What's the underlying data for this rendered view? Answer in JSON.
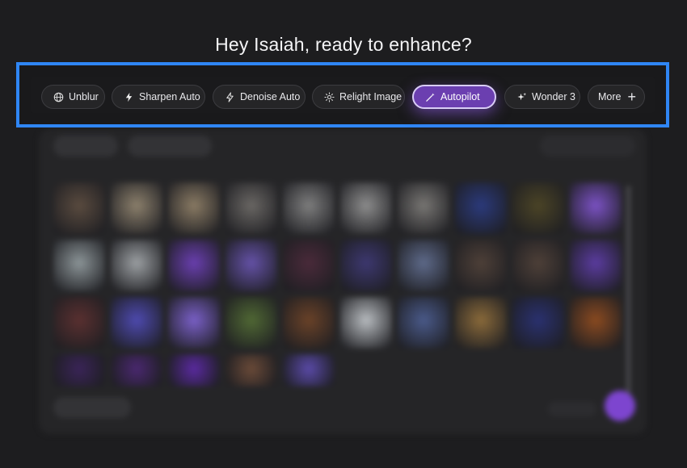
{
  "greeting": "Hey Isaiah, ready to enhance?",
  "toolbar": {
    "chips": [
      {
        "label": "Unblur",
        "icon": "globe-icon"
      },
      {
        "label": "Sharpen Auto",
        "icon": "bolt-filled-icon"
      },
      {
        "label": "Denoise Auto",
        "icon": "bolt-outline-icon"
      },
      {
        "label": "Relight Image",
        "icon": "sun-icon"
      },
      {
        "label": "Autopilot",
        "icon": "magic-wand-icon",
        "active": true
      },
      {
        "label": "Wonder 3",
        "icon": "sparkle-icon"
      },
      {
        "label": "More",
        "icon": "plus-icon"
      }
    ]
  },
  "colors": {
    "highlight_border": "#2f86f5",
    "active_chip": "#6b3fb0",
    "background": "#1d1d1f"
  },
  "thumbnails": [
    [
      "#5a4b3f",
      "#8c806c",
      "#8a7b64",
      "#6a6764",
      "#7e7e7e",
      "#8d8d8d",
      "#787673",
      "#2b3a7c",
      "#4b4426",
      "#7b52c4"
    ],
    [
      "#8c9598",
      "#9ca0a3",
      "#6a3fb0",
      "#6552a8",
      "#4a2a3a",
      "#3d3870",
      "#5e6a8a",
      "#4e4038",
      "#4e4038",
      "#5b3ca0"
    ],
    [
      "#5a3030",
      "#4e4ab0",
      "#7a60c8",
      "#506834",
      "#6a4228",
      "#b8bcc0",
      "#4a5a8a",
      "#8a6a3a",
      "#2a3170",
      "#8a4a20"
    ],
    [
      "#3a2458",
      "#4a2870",
      "#5a2aa0",
      "#6a4a38",
      "#5a4aa8"
    ]
  ]
}
